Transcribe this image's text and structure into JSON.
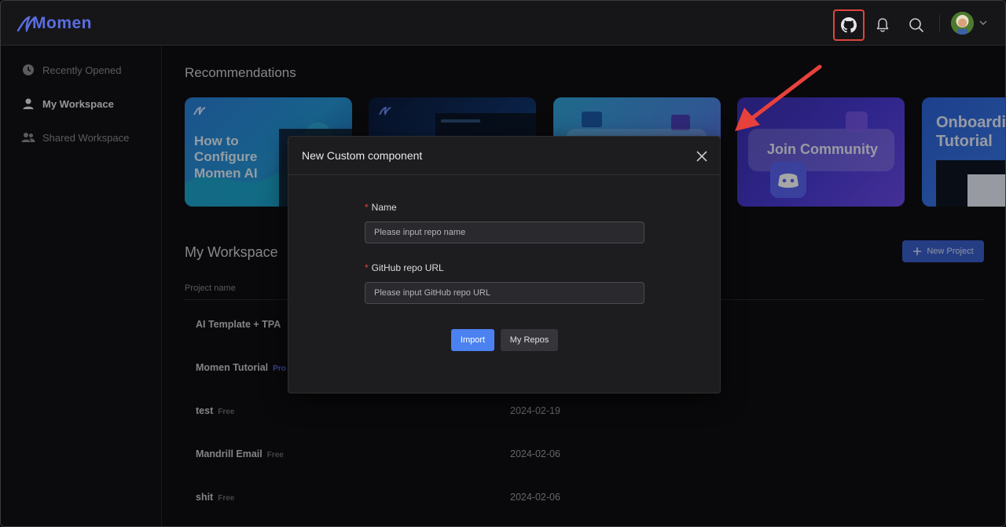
{
  "app": {
    "logo_text": "Momen"
  },
  "header": {
    "icons": [
      "github-icon",
      "bell-icon",
      "search-icon",
      "avatar",
      "chevron-down-icon"
    ],
    "highlight_color": "#e0443e"
  },
  "sidebar": {
    "items": [
      {
        "label": "Recently Opened",
        "icon": "clock-icon",
        "active": false
      },
      {
        "label": "My Workspace",
        "icon": "user-icon",
        "active": true
      },
      {
        "label": "Shared Workspace",
        "icon": "users-icon",
        "active": false
      }
    ]
  },
  "recommendations": {
    "title": "Recommendations",
    "cards": [
      {
        "text": "How to Configure Momen AI"
      },
      {
        "text": ""
      },
      {
        "text": ""
      },
      {
        "text": "Join Community"
      },
      {
        "text": "Onboarding Tutorial"
      }
    ]
  },
  "workspace": {
    "title": "My Workspace",
    "new_project_label": "New Project",
    "column_project_name": "Project name",
    "projects": [
      {
        "name": "AI Template + TPA",
        "badge": "",
        "date": ""
      },
      {
        "name": "Momen Tutorial",
        "badge": "Pro",
        "date": ""
      },
      {
        "name": "test",
        "badge": "Free",
        "date": "2024-02-19"
      },
      {
        "name": "Mandrill Email",
        "badge": "Free",
        "date": "2024-02-06"
      },
      {
        "name": "shit",
        "badge": "Free",
        "date": "2024-02-06"
      }
    ]
  },
  "modal": {
    "title": "New Custom component",
    "name_label": "Name",
    "name_placeholder": "Please input repo name",
    "url_label": "GitHub repo URL",
    "url_placeholder": "Please input GitHub repo URL",
    "required_mark": "*",
    "import_label": "Import",
    "repos_label": "My Repos"
  }
}
